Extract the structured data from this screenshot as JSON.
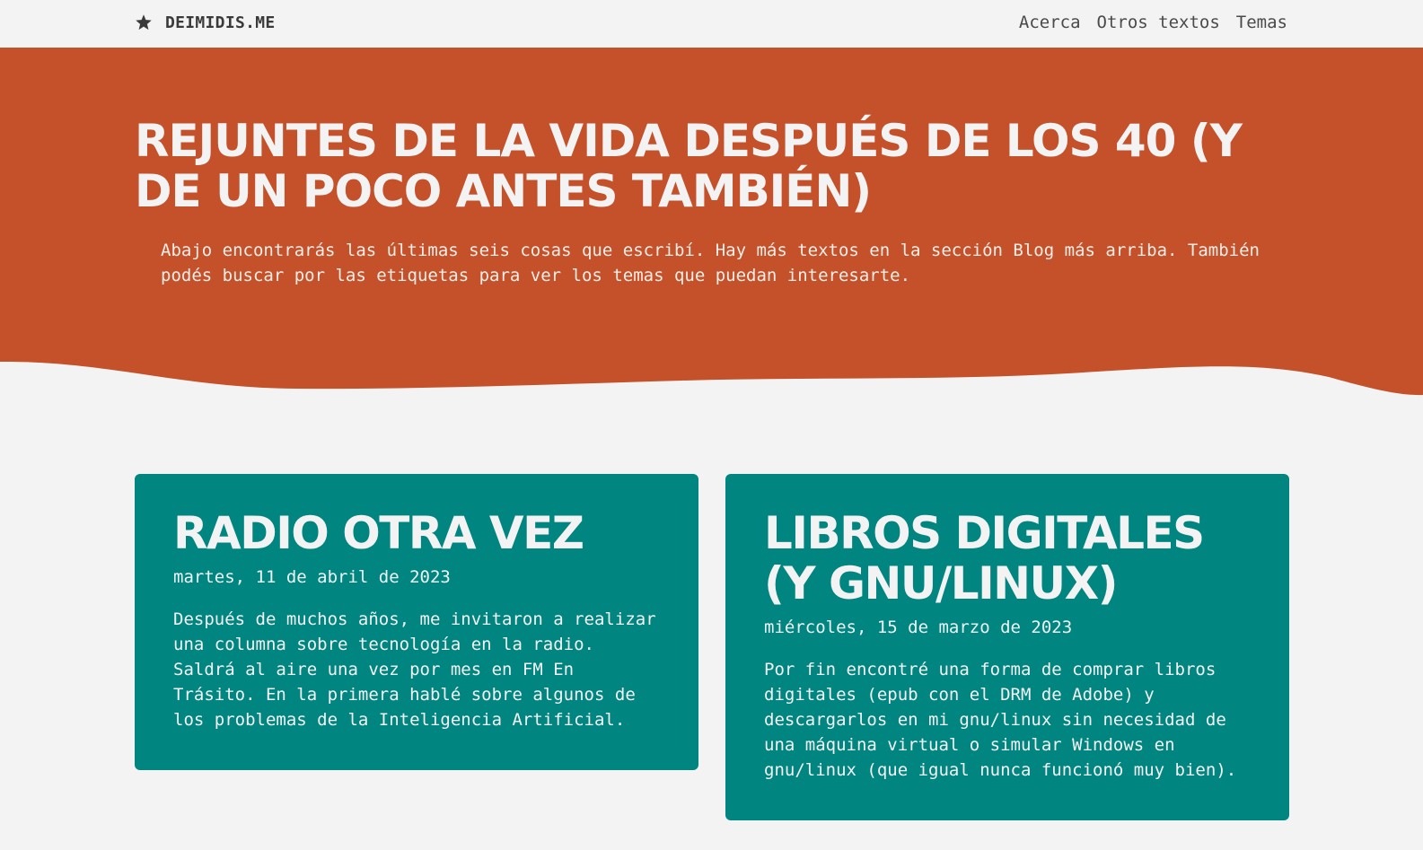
{
  "site": {
    "brand": "DEIMIDIS.ME",
    "nav": [
      "Acerca",
      "Otros textos",
      "Temas"
    ]
  },
  "hero": {
    "title": "Rejuntes de la vida después de los 40 (y de un poco antes también)",
    "description": "Abajo encontrarás las últimas seis cosas que escribí. Hay más textos en la sección Blog más arriba. También podés buscar por las etiquetas para ver los temas que puedan interesarte."
  },
  "posts": [
    {
      "title": "Radio otra vez",
      "date": "martes, 11 de abril de 2023",
      "excerpt": "Después de muchos años, me invitaron a realizar una columna sobre tecnología en la radio. Saldrá al aire una vez por mes en FM En Trásito. En la primera hablé sobre algunos de los problemas de la Inteligencia Artificial."
    },
    {
      "title": "Libros digitales (y gnu/linux)",
      "date": "miércoles, 15 de marzo de 2023",
      "excerpt": "Por fin encontré una forma de comprar libros digitales (epub con el DRM de Adobe) y descargarlos en mi gnu/linux sin necesidad de una máquina virtual o simular Windows en gnu/linux (que igual nunca funcionó muy bien)."
    }
  ],
  "colors": {
    "hero": "#c4512a",
    "card": "#008580",
    "background": "#f3f3f3",
    "text_light": "#f3f3f3"
  },
  "icons": {
    "brand": "star-icon"
  }
}
